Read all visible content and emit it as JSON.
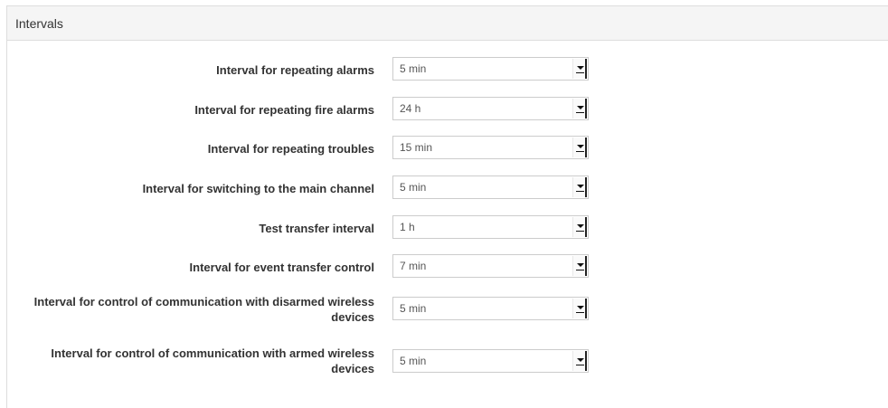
{
  "panel": {
    "title": "Intervals"
  },
  "rows": [
    {
      "label": "Interval for repeating alarms",
      "value": "5 min"
    },
    {
      "label": "Interval for repeating fire alarms",
      "value": "24 h"
    },
    {
      "label": "Interval for repeating troubles",
      "value": "15 min"
    },
    {
      "label": "Interval for switching to the main channel",
      "value": "5 min"
    },
    {
      "label": "Test transfer interval",
      "value": "1 h"
    },
    {
      "label": "Interval for event transfer control",
      "value": "7 min"
    },
    {
      "label": "Interval for control of communication with disarmed wireless devices",
      "value": "5 min"
    },
    {
      "label": "Interval for control of communication with armed wireless devices",
      "value": "5 min"
    }
  ],
  "icons": {
    "dropdown": "chevron-down-icon"
  }
}
